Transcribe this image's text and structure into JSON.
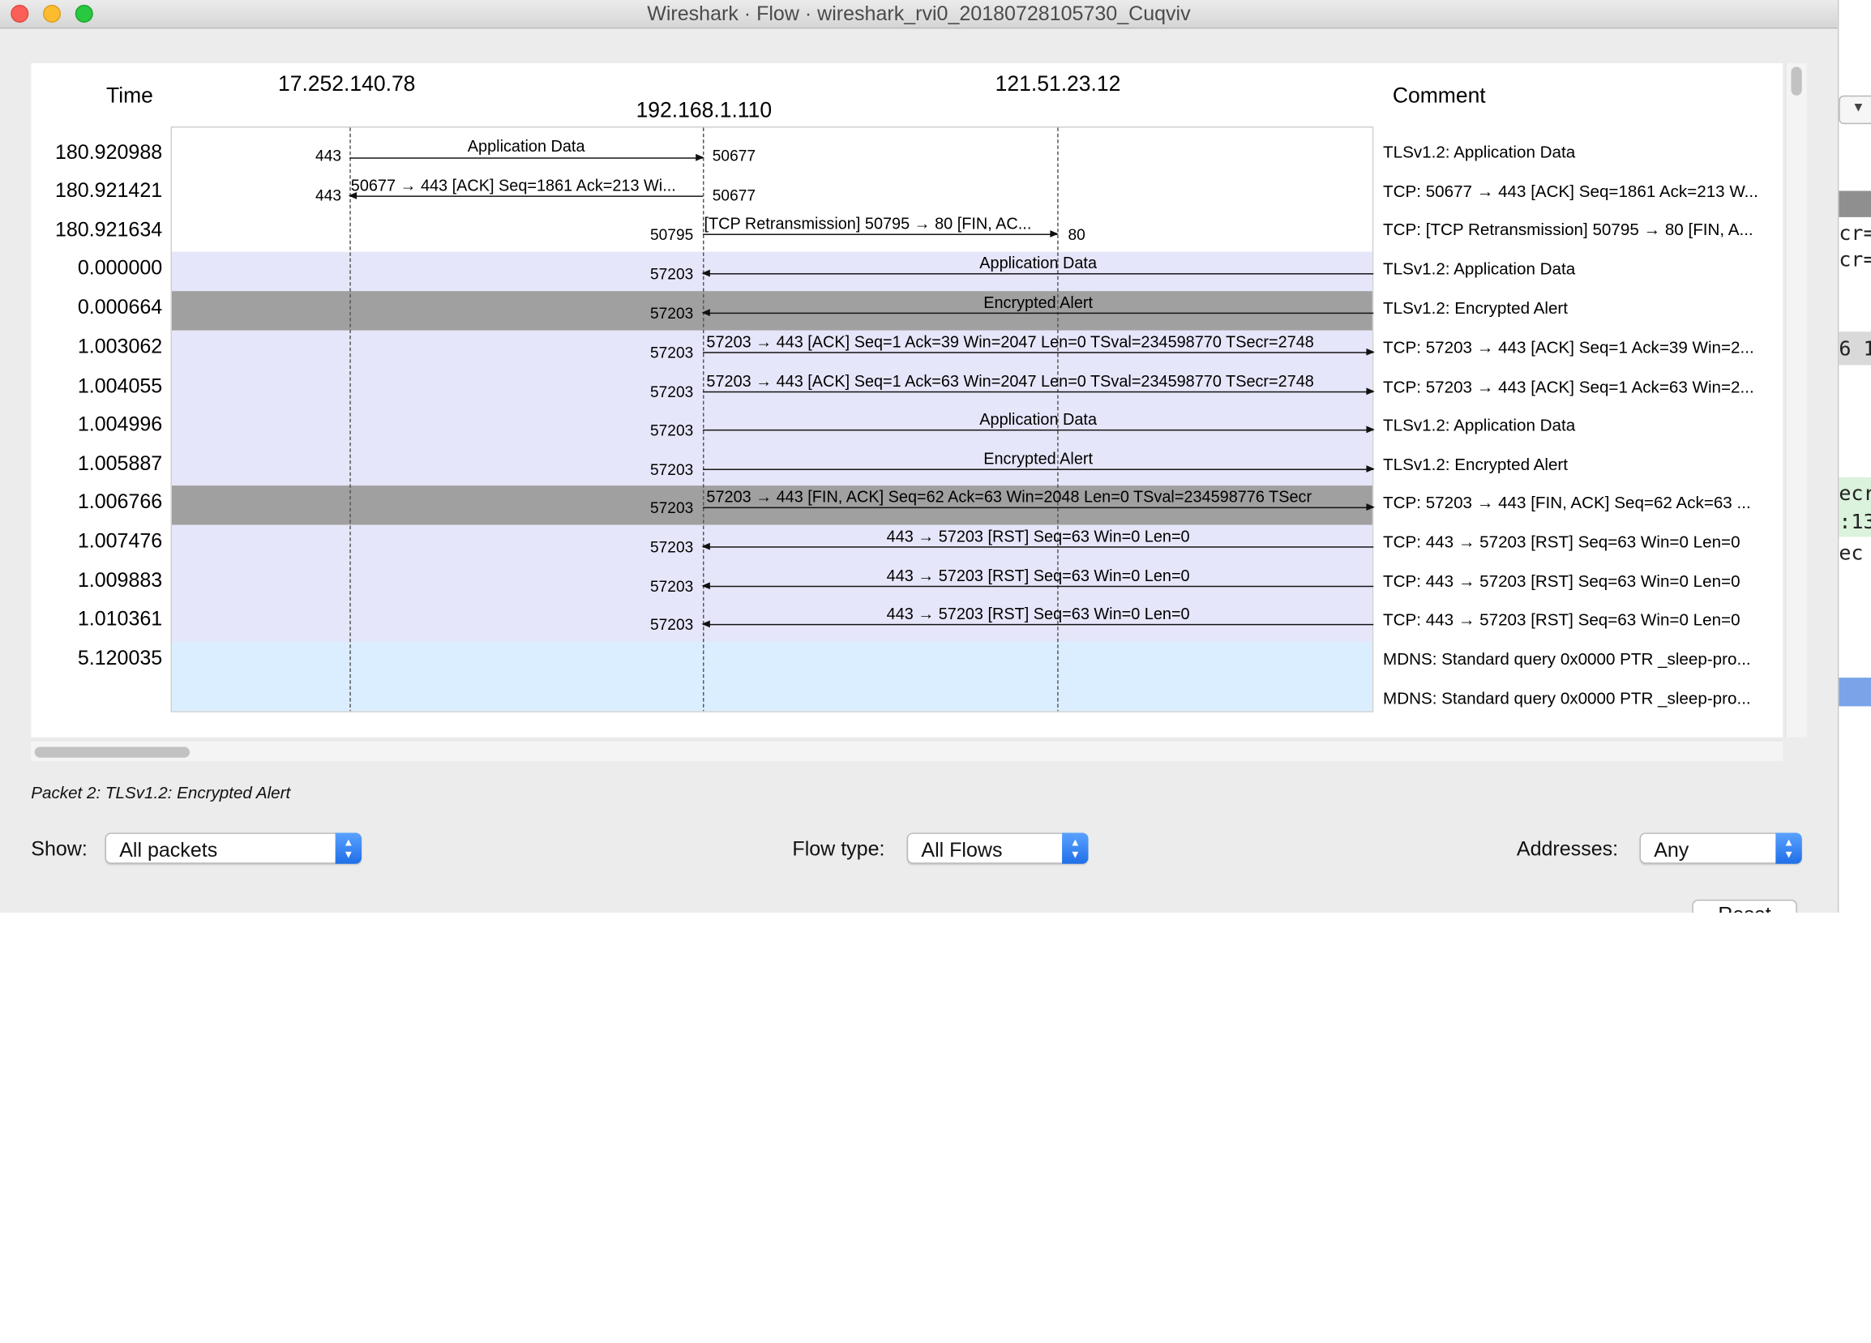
{
  "window": {
    "title": "Wireshark · Flow · wireshark_rvi0_20180728105730_Cuqviv"
  },
  "header": {
    "time_label": "Time",
    "comment_label": "Comment",
    "hosts": [
      "17.252.140.78",
      "192.168.1.110",
      "121.51.23.12"
    ]
  },
  "rows": [
    {
      "time": "180.920988",
      "src_port": "443",
      "dst_port": "50677",
      "label": "Application Data",
      "comment": "TLSv1.2: Application Data"
    },
    {
      "time": "180.921421",
      "src_port": "50677",
      "dst_port": "443",
      "label": "50677 → 443 [ACK] Seq=1861 Ack=213 Wi...",
      "comment": "TCP: 50677 → 443 [ACK] Seq=1861 Ack=213 W..."
    },
    {
      "time": "180.921634",
      "src_port": "50795",
      "dst_port": "80",
      "label": "[TCP Retransmission] 50795 → 80 [FIN, AC...",
      "comment": "TCP: [TCP Retransmission] 50795 → 80 [FIN, A..."
    },
    {
      "time": "0.000000",
      "port": "57203",
      "label": "Application Data",
      "comment": "TLSv1.2: Application Data"
    },
    {
      "time": "0.000664",
      "port": "57203",
      "label": "Encrypted Alert",
      "comment": "TLSv1.2: Encrypted Alert"
    },
    {
      "time": "1.003062",
      "port": "57203",
      "label": "57203 → 443 [ACK] Seq=1 Ack=39 Win=2047 Len=0 TSval=234598770 TSecr=2748",
      "comment": "TCP: 57203 → 443 [ACK] Seq=1 Ack=39 Win=2..."
    },
    {
      "time": "1.004055",
      "port": "57203",
      "label": "57203 → 443 [ACK] Seq=1 Ack=63 Win=2047 Len=0 TSval=234598770 TSecr=2748",
      "comment": "TCP: 57203 → 443 [ACK] Seq=1 Ack=63 Win=2..."
    },
    {
      "time": "1.004996",
      "port": "57203",
      "label": "Application Data",
      "comment": "TLSv1.2: Application Data"
    },
    {
      "time": "1.005887",
      "port": "57203",
      "label": "Encrypted Alert",
      "comment": "TLSv1.2: Encrypted Alert"
    },
    {
      "time": "1.006766",
      "port": "57203",
      "label": "57203 → 443 [FIN, ACK] Seq=62 Ack=63 Win=2048 Len=0 TSval=234598776 TSecr",
      "comment": "TCP: 57203 → 443 [FIN, ACK] Seq=62 Ack=63 ..."
    },
    {
      "time": "1.007476",
      "port": "57203",
      "label": "443 → 57203 [RST] Seq=63 Win=0 Len=0",
      "comment": "TCP: 443 → 57203 [RST] Seq=63 Win=0 Len=0"
    },
    {
      "time": "1.009883",
      "port": "57203",
      "label": "443 → 57203 [RST] Seq=63 Win=0 Len=0",
      "comment": "TCP: 443 → 57203 [RST] Seq=63 Win=0 Len=0"
    },
    {
      "time": "1.010361",
      "port": "57203",
      "label": "443 → 57203 [RST] Seq=63 Win=0 Len=0",
      "comment": "TCP: 443 → 57203 [RST] Seq=63 Win=0 Len=0"
    },
    {
      "time": "5.120035",
      "comment": "MDNS: Standard query 0x0000 PTR _sleep-pro..."
    },
    {
      "time": "",
      "comment": "MDNS: Standard query 0x0000 PTR _sleep-pro..."
    }
  ],
  "status": {
    "text": "Packet 2: TLSv1.2: Encrypted Alert"
  },
  "controls": {
    "show_label": "Show:",
    "show_value": "All packets",
    "flow_type_label": "Flow type:",
    "flow_type_value": "All Flows",
    "addresses_label": "Addresses:",
    "addresses_value": "Any",
    "reset_label": "Reset"
  },
  "background_window": {
    "fragments": [
      "cr=",
      "cr=",
      "6 1",
      "ecr",
      ":13",
      "ec"
    ]
  },
  "colors": {
    "row_lavender": "#e6e6fa",
    "row_selected_gray": "#a0a0a0",
    "row_mdns_blue": "#daeeff",
    "combo_accent": "#1f6fe8"
  }
}
